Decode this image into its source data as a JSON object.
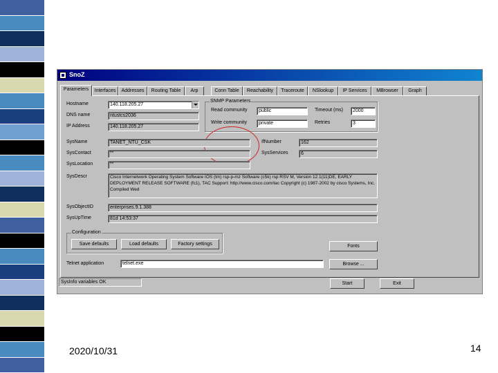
{
  "strip_colors": [
    "#3f5f9f",
    "#4a8bbf",
    "#0f2f5f",
    "#9fb3d9",
    "#000000",
    "#d9d9b0",
    "#4a8bbf",
    "#1a3f7f",
    "#6f9fcf",
    "#000000",
    "#4a8bbf",
    "#9fb3d9",
    "#0f2f5f",
    "#d9d9b0",
    "#3f5f9f",
    "#000000",
    "#4a8bbf",
    "#1a3f7f",
    "#9fb3d9",
    "#0f2f5f",
    "#d9d9b0",
    "#000000",
    "#4a8bbf",
    "#3f5f9f"
  ],
  "window": {
    "title": "SnoZ"
  },
  "tabs": [
    "Parameters",
    "Interfaces",
    "Addresses",
    "Routing Table",
    "Arp",
    "Conn Table",
    "Reachability",
    "Traceroute",
    "NSlookup",
    "IP Services",
    "MBrowser",
    "Graph"
  ],
  "form": {
    "hostname_label": "Hostname",
    "hostname_value": "140.118.205.27",
    "dns_label": "DNS name",
    "dns_value": "ntustcs2036",
    "ip_label": "IP Address",
    "ip_value": "140.118.205.27",
    "sysname_label": "SysName",
    "sysname_value": "TANET_NTU_CSK",
    "syscontact_label": "SysContact",
    "syscontact_value": "\"\"",
    "syslocation_label": "SysLocation",
    "syslocation_value": "\"\"",
    "sysdescr_label": "SysDescr",
    "sysdescr_value": "Cisco Internetwork Operating System Software IOS (tm) rsp-p-mz Software (c5k) rsp RSV M, Version 12.1(11)DE, EARLY DEPLOYMENT RELEASE SOFTWARE (fc1), TAC Support: http://www.cisco.com/tac Copyright (c) 1987-2002 by cisco Systems, Inc. Compiled Wed",
    "sysobjectid_label": "SysObjectID",
    "sysobjectid_value": "enterprises.9.1.388",
    "sysuptime_label": "SysUpTime",
    "sysuptime_value": "81d 14:53:37",
    "ifnumber_label": "IfNumber",
    "ifnumber_value": "162",
    "sysservices_label": "SysServices",
    "sysservices_value": "6"
  },
  "snmp": {
    "group_title": "SNMP Parameters",
    "read_label": "Read community",
    "read_value": "public",
    "write_label": "Write community",
    "write_value": "private",
    "timeout_label": "Timeout (ms)",
    "timeout_value": "2000",
    "retries_label": "Retries",
    "retries_value": "3"
  },
  "config": {
    "group_title": "Configuration",
    "save_label": "Save defaults",
    "load_label": "Load defaults",
    "factory_label": "Factory settings"
  },
  "buttons": {
    "fonts": "Fonts",
    "browse": "Browse ...",
    "start": "Start",
    "exit": "Exit"
  },
  "telnet": {
    "label": "Telnet application",
    "value": "telnet.exe"
  },
  "status": "SysInfo variables OK",
  "footer": {
    "date": "2020/10/31",
    "page": "14"
  }
}
